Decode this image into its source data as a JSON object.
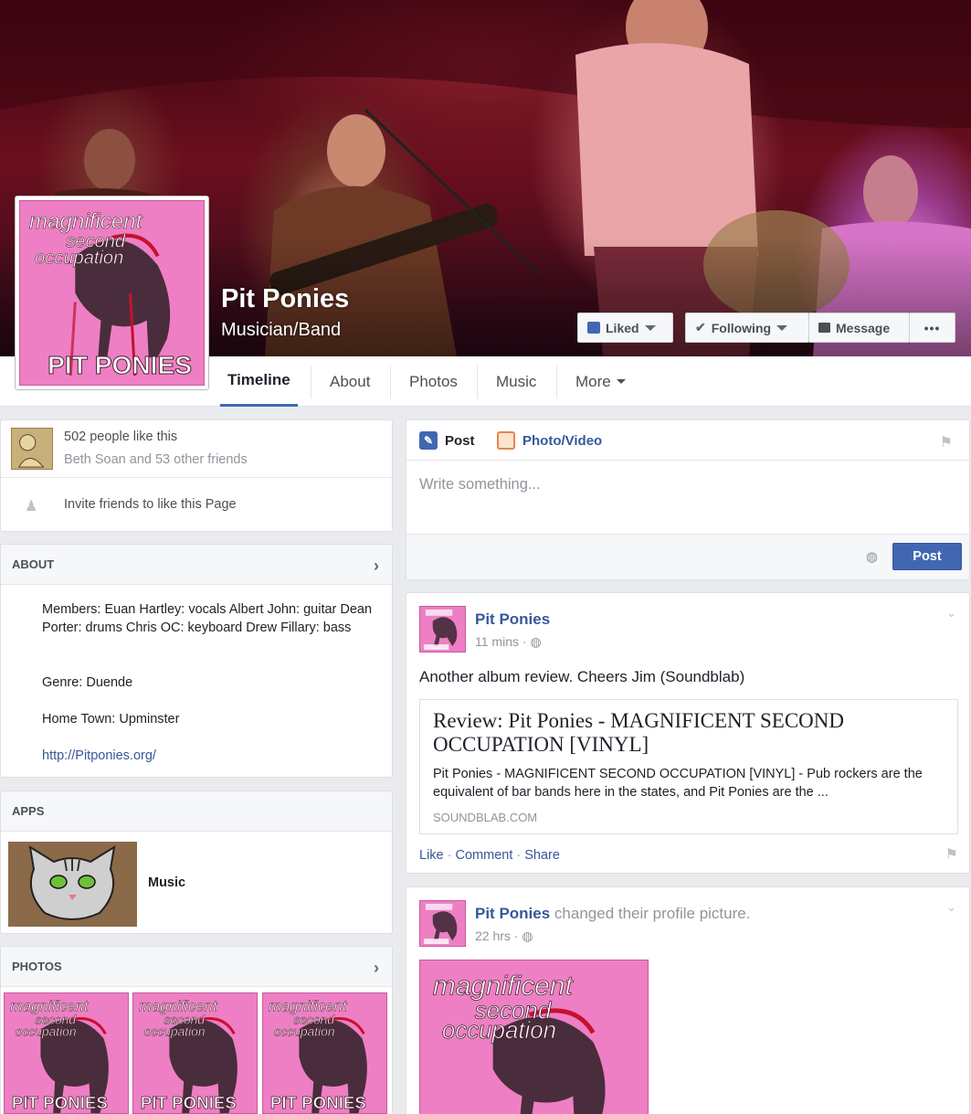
{
  "header": {
    "page_name": "Pit Ponies",
    "category": "Musician/Band",
    "buttons": {
      "liked": "Liked",
      "following": "Following",
      "message": "Message",
      "more_dots": "•••"
    }
  },
  "album_art": {
    "line1": "magnificent",
    "line2": "second",
    "line3": "occupation",
    "band": "PIT PONIES"
  },
  "tabs": [
    "Timeline",
    "About",
    "Photos",
    "Music",
    "More"
  ],
  "likes": {
    "count_text": "502 people like this",
    "friends_text": "Beth Soan and 53 other friends",
    "invite_text": "Invite friends to like this Page"
  },
  "about": {
    "title": "ABOUT",
    "members": "Members: Euan Hartley: vocals Albert John: guitar Dean Porter: drums Chris OC: keyboard Drew Fillary: bass",
    "genre": "Genre: Duende",
    "hometown": "Home Town: Upminster",
    "website": "http://Pitponies.org/"
  },
  "apps": {
    "title": "APPS",
    "item_label": "Music"
  },
  "photos": {
    "title": "PHOTOS"
  },
  "composer": {
    "post_tab": "Post",
    "photo_tab": "Photo/Video",
    "placeholder": "Write something...",
    "post_button": "Post"
  },
  "post1": {
    "author": "Pit Ponies",
    "time": "11 mins",
    "text": "Another album review. Cheers Jim (Soundblab)",
    "link_title": "Review: Pit Ponies - MAGNIFICENT SECOND OCCUPATION [VINYL]",
    "link_desc": "Pit Ponies - MAGNIFICENT SECOND OCCUPATION [VINYL] - Pub rockers are the equivalent of bar bands here in the states, and Pit Ponies are the ...",
    "link_domain": "SOUNDBLAB.COM",
    "actions": {
      "like": "Like",
      "comment": "Comment",
      "share": "Share"
    }
  },
  "post2": {
    "author": "Pit Ponies",
    "action_text": "changed their profile picture.",
    "time": "22 hrs"
  },
  "colors": {
    "facebook_blue": "#4267b2",
    "link_blue": "#365899",
    "album_pink": "#ee7fc4"
  }
}
